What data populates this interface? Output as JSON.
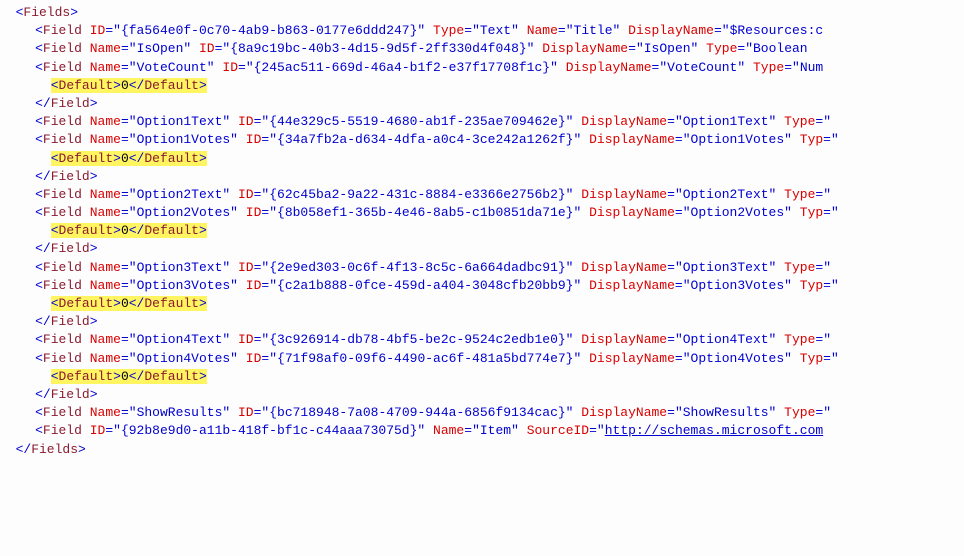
{
  "root": {
    "tag": "Fields"
  },
  "defTag": "Default",
  "defVal": "0",
  "closeField": "Field",
  "lines": [
    {
      "kind": "fields-open"
    },
    {
      "kind": "field-self",
      "attrs": [
        [
          "ID",
          "{fa564e0f-0c70-4ab9-b863-0177e6ddd247}"
        ],
        [
          "Type",
          "Text"
        ],
        [
          "Name",
          "Title"
        ],
        [
          "DisplayName",
          "$Resources:c"
        ]
      ],
      "cut": true
    },
    {
      "kind": "field-self",
      "attrs": [
        [
          "Name",
          "IsOpen"
        ],
        [
          "ID",
          "{8a9c19bc-40b3-4d15-9d5f-2ff330d4f048}"
        ],
        [
          "DisplayName",
          "IsOpen"
        ],
        [
          "Type",
          "Boolean"
        ]
      ],
      "cut": true
    },
    {
      "kind": "field-open",
      "attrs": [
        [
          "Name",
          "VoteCount"
        ],
        [
          "ID",
          "{245ac511-669d-46a4-b1f2-e37f17708f1c}"
        ],
        [
          "DisplayName",
          "VoteCount"
        ],
        [
          "Type",
          "Num"
        ]
      ],
      "cut": true
    },
    {
      "kind": "default"
    },
    {
      "kind": "close-field"
    },
    {
      "kind": "field-self",
      "attrs": [
        [
          "Name",
          "Option1Text"
        ],
        [
          "ID",
          "{44e329c5-5519-4680-ab1f-235ae709462e}"
        ],
        [
          "DisplayName",
          "Option1Text"
        ],
        [
          "Type",
          ""
        ]
      ],
      "cut": true
    },
    {
      "kind": "field-open",
      "attrs": [
        [
          "Name",
          "Option1Votes"
        ],
        [
          "ID",
          "{34a7fb2a-d634-4dfa-a0c4-3ce242a1262f}"
        ],
        [
          "DisplayName",
          "Option1Votes"
        ],
        [
          "Typ",
          ""
        ]
      ],
      "cut": true
    },
    {
      "kind": "default"
    },
    {
      "kind": "close-field"
    },
    {
      "kind": "field-self",
      "attrs": [
        [
          "Name",
          "Option2Text"
        ],
        [
          "ID",
          "{62c45ba2-9a22-431c-8884-e3366e2756b2}"
        ],
        [
          "DisplayName",
          "Option2Text"
        ],
        [
          "Type",
          ""
        ]
      ],
      "cut": true
    },
    {
      "kind": "field-open",
      "attrs": [
        [
          "Name",
          "Option2Votes"
        ],
        [
          "ID",
          "{8b058ef1-365b-4e46-8ab5-c1b0851da71e}"
        ],
        [
          "DisplayName",
          "Option2Votes"
        ],
        [
          "Typ",
          ""
        ]
      ],
      "cut": true
    },
    {
      "kind": "default"
    },
    {
      "kind": "close-field"
    },
    {
      "kind": "field-self",
      "attrs": [
        [
          "Name",
          "Option3Text"
        ],
        [
          "ID",
          "{2e9ed303-0c6f-4f13-8c5c-6a664dadbc91}"
        ],
        [
          "DisplayName",
          "Option3Text"
        ],
        [
          "Type",
          ""
        ]
      ],
      "cut": true
    },
    {
      "kind": "field-open",
      "attrs": [
        [
          "Name",
          "Option3Votes"
        ],
        [
          "ID",
          "{c2a1b888-0fce-459d-a404-3048cfb20bb9}"
        ],
        [
          "DisplayName",
          "Option3Votes"
        ],
        [
          "Typ",
          ""
        ]
      ],
      "cut": true
    },
    {
      "kind": "default"
    },
    {
      "kind": "close-field"
    },
    {
      "kind": "field-self",
      "attrs": [
        [
          "Name",
          "Option4Text"
        ],
        [
          "ID",
          "{3c926914-db78-4bf5-be2c-9524c2edb1e0}"
        ],
        [
          "DisplayName",
          "Option4Text"
        ],
        [
          "Type",
          ""
        ]
      ],
      "cut": true
    },
    {
      "kind": "field-open",
      "attrs": [
        [
          "Name",
          "Option4Votes"
        ],
        [
          "ID",
          "{71f98af0-09f6-4490-ac6f-481a5bd774e7}"
        ],
        [
          "DisplayName",
          "Option4Votes"
        ],
        [
          "Typ",
          ""
        ]
      ],
      "cut": true
    },
    {
      "kind": "default"
    },
    {
      "kind": "close-field"
    },
    {
      "kind": "field-self",
      "attrs": [
        [
          "Name",
          "ShowResults"
        ],
        [
          "ID",
          "{bc718948-7a08-4709-944a-6856f9134cac}"
        ],
        [
          "DisplayName",
          "ShowResults"
        ],
        [
          "Type",
          ""
        ]
      ],
      "cut": true
    },
    {
      "kind": "field-url",
      "attrs": [
        [
          "ID",
          "{92b8e9d0-a11b-418f-bf1c-c44aaa73075d}"
        ],
        [
          "Name",
          "Item"
        ]
      ],
      "urlAttr": "SourceID",
      "url": "http://schemas.microsoft.com"
    },
    {
      "kind": "fields-close"
    }
  ]
}
